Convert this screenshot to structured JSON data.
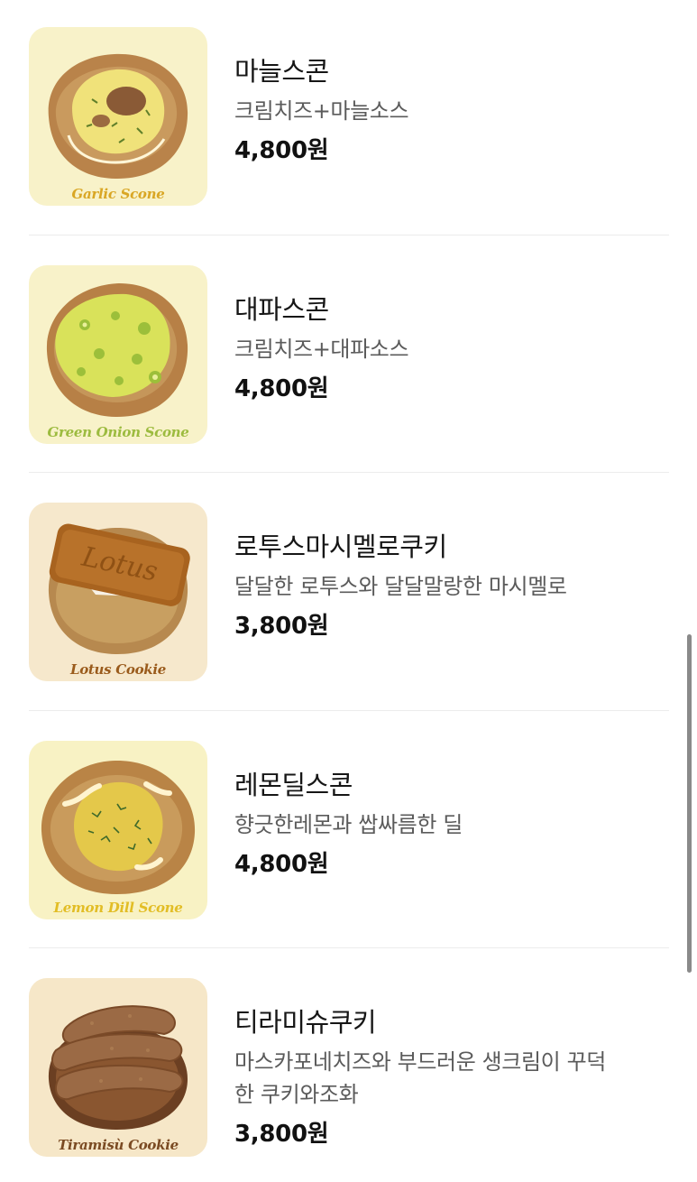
{
  "menu": {
    "items": [
      {
        "name": "마늘스콘",
        "desc": "크림치즈+마늘소스",
        "price": "4,800원",
        "caption": "Garlic Scone",
        "caption_color": "#d9a624",
        "bg": "#f8f2c9",
        "image": "garlic-scone-image"
      },
      {
        "name": "대파스콘",
        "desc": "크림치즈+대파소스",
        "price": "4,800원",
        "caption": "Green Onion Scone",
        "caption_color": "#9cbb3f",
        "bg": "#f8f2c9",
        "image": "green-onion-scone-image"
      },
      {
        "name": "로투스마시멜로쿠키",
        "desc": "달달한 로투스와 달달말랑한 마시멜로",
        "price": "3,800원",
        "caption": "Lotus Cookie",
        "caption_color": "#9a5b1c",
        "bg": "#f6e8cc",
        "image": "lotus-cookie-image"
      },
      {
        "name": "레몬딜스콘",
        "desc": "향긋한레몬과 쌉싸름한 딜",
        "price": "4,800원",
        "caption": "Lemon Dill Scone",
        "caption_color": "#e2bd25",
        "bg": "#f8f2c4",
        "image": "lemon-dill-scone-image"
      },
      {
        "name": "티라미슈쿠키",
        "desc_lines": [
          "마스카포네치즈와 부드러운 생크림이 꾸덕",
          "한 쿠키와조화"
        ],
        "price": "3,800원",
        "caption": "Tiramisù Cookie",
        "caption_color": "#7a4a22",
        "bg": "#f6e7c8",
        "image": "tiramisu-cookie-image"
      }
    ]
  }
}
